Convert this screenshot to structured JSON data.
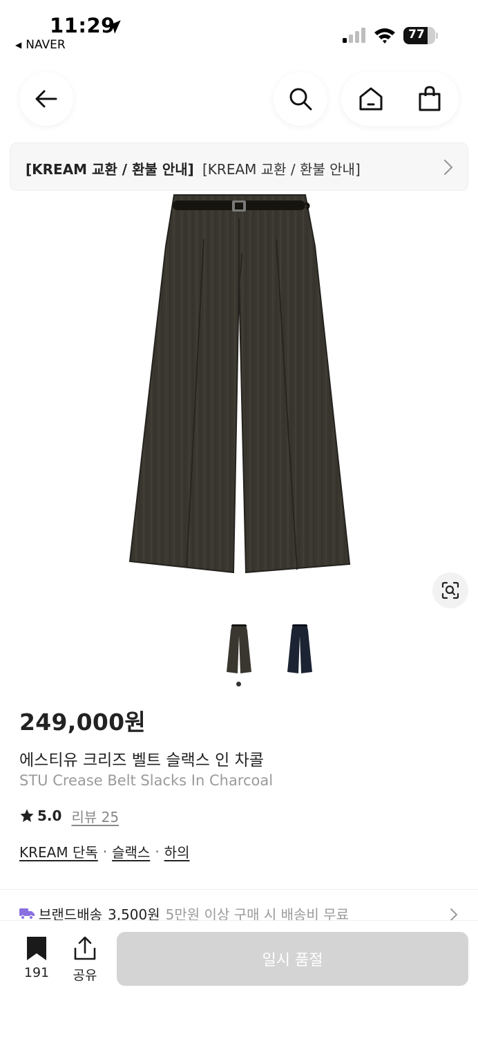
{
  "status_bar": {
    "time": "11:29",
    "back_app": "NAVER",
    "battery": "77",
    "battery_level": 0.77
  },
  "header": {
    "back_icon": "arrow-left-icon",
    "search_icon": "search-icon",
    "home_icon": "home-icon",
    "cart_icon": "shopping-bag-icon"
  },
  "notice": {
    "title": "[KREAM 교환 / 환불 안내]",
    "text": "[KREAM 교환 / 환불 안내]"
  },
  "product": {
    "price": "249,000원",
    "name_ko": "에스티유 크리즈 벨트 슬랙스 인 차콜",
    "name_en": "STU Crease Belt Slacks In Charcoal",
    "rating": "5.0",
    "reviews": "리뷰 25",
    "categories": [
      "KREAM 단독",
      "슬랙스",
      "하의"
    ],
    "separator": "·",
    "thumbnail_colors": [
      "#3a3730",
      "#1c2433"
    ]
  },
  "shipping": {
    "label": "브랜드배송",
    "fee": "3,500원",
    "condition": "5만원 이상 구매 시 배송비 무료",
    "accent_color": "#8a6fe0"
  },
  "bottom_bar": {
    "bookmark_count": "191",
    "share_label": "공유",
    "action_label": "일시 품절"
  }
}
